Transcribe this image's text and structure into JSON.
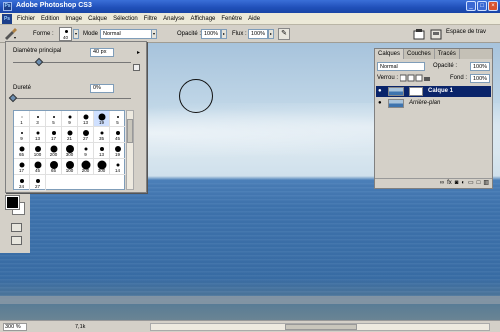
{
  "window": {
    "title": "Adobe Photoshop CS3",
    "logo": "Ps",
    "controls": [
      "_",
      "□",
      "×"
    ]
  },
  "menu": [
    "Fichier",
    "Edition",
    "Image",
    "Calque",
    "Sélection",
    "Filtre",
    "Analyse",
    "Affichage",
    "Fenêtre",
    "Aide"
  ],
  "options": {
    "forme_label": "Forme :",
    "brush_size": "40",
    "mode_label": "Mode :",
    "mode_value": "Normal",
    "opacite_label": "Opacité :",
    "opacite_value": "100%",
    "flux_label": "Flux :",
    "flux_value": "100%",
    "workspace_label": "Espace de trav"
  },
  "brush_panel": {
    "diametre_label": "Diamètre principal",
    "diametre_value": "40 px",
    "durete_label": "Dureté",
    "durete_value": "0%",
    "diametre_fraction": 0.22,
    "durete_fraction": 0.0,
    "presets": [
      {
        "n": "1",
        "s": 1
      },
      {
        "n": "3",
        "s": 2
      },
      {
        "n": "5",
        "s": 2
      },
      {
        "n": "9",
        "s": 3
      },
      {
        "n": "13",
        "s": 5
      },
      {
        "n": "19",
        "s": 7
      },
      {
        "n": "5",
        "s": 2
      },
      {
        "n": "9",
        "s": 2
      },
      {
        "n": "13",
        "s": 3
      },
      {
        "n": "17",
        "s": 4
      },
      {
        "n": "21",
        "s": 5
      },
      {
        "n": "27",
        "s": 6
      },
      {
        "n": "35",
        "s": 3
      },
      {
        "n": "45",
        "s": 4
      },
      {
        "n": "65",
        "s": 5
      },
      {
        "n": "100",
        "s": 6
      },
      {
        "n": "200",
        "s": 7
      },
      {
        "n": "300",
        "s": 8
      },
      {
        "n": "9",
        "s": 3
      },
      {
        "n": "13",
        "s": 4
      },
      {
        "n": "19",
        "s": 6
      },
      {
        "n": "17",
        "s": 5
      },
      {
        "n": "45",
        "s": 7
      },
      {
        "n": "65",
        "s": 8
      },
      {
        "n": "100",
        "s": 8
      },
      {
        "n": "200",
        "s": 9
      },
      {
        "n": "300",
        "s": 9
      },
      {
        "n": "14",
        "s": 3
      },
      {
        "n": "24",
        "s": 4
      },
      {
        "n": "27",
        "s": 4
      }
    ]
  },
  "layers_panel": {
    "tabs": [
      "Calques",
      "Couches",
      "Tracés"
    ],
    "blend_mode": "Normal",
    "opacite_label": "Opacité :",
    "opacite_value": "100%",
    "verrou_label": "Verrou :",
    "fond_label": "Fond :",
    "fond_value": "100%",
    "layers": [
      {
        "name": "Calque 1",
        "selected": true
      },
      {
        "name": "Arrière-plan",
        "selected": false
      }
    ],
    "footer_icons": [
      "link-icon",
      "fx-icon",
      "mask-icon",
      "adjustment-icon",
      "folder-icon",
      "new-layer-icon",
      "trash-icon"
    ]
  },
  "status": {
    "zoom": "300 %",
    "doc": "7,1k"
  },
  "colors": {
    "foreground": "#000000",
    "background": "#ffffff",
    "selection": "#0a246a"
  }
}
